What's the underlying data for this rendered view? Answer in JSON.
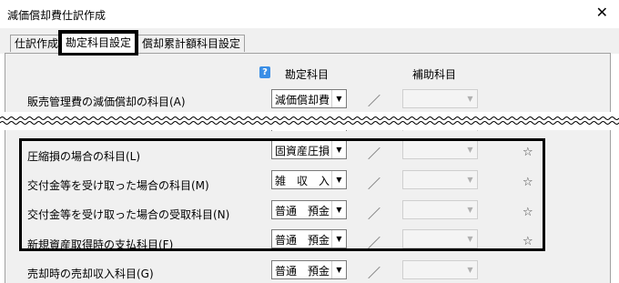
{
  "window": {
    "title": "減価償却費仕訳作成",
    "close_glyph": "✕"
  },
  "tabs": [
    {
      "label": "仕訳作成"
    },
    {
      "label": "勘定科目設定",
      "active": true
    },
    {
      "label": "償却累計額科目設定"
    }
  ],
  "columns": {
    "account_header": "勘定科目",
    "sub_header": "補助科目",
    "help_icon": "?"
  },
  "separator": "／",
  "star": "☆",
  "rows": [
    {
      "label": "販売管理費の減価償却の科目(A)",
      "account": "減価償却費",
      "starred": false
    },
    {
      "label": "圧縮損の場合の科目(L)",
      "account": "固資産圧損",
      "starred": true
    },
    {
      "label": "交付金等を受け取った場合の科目(M)",
      "account": "雑　収　入",
      "starred": true
    },
    {
      "label": "交付金等を受け取った場合の受取科目(N)",
      "account": "普通　預金",
      "starred": true
    },
    {
      "label": "新規資産取得時の支払科目(F)",
      "account": "普通　預金",
      "starred": true
    },
    {
      "label": "売却時の売却収入科目(G)",
      "account": "普通　預金",
      "starred": false
    }
  ],
  "colors": {
    "panel": "#f0f0f0",
    "highlight": "#000000",
    "help_icon": "#3a8ee6"
  }
}
